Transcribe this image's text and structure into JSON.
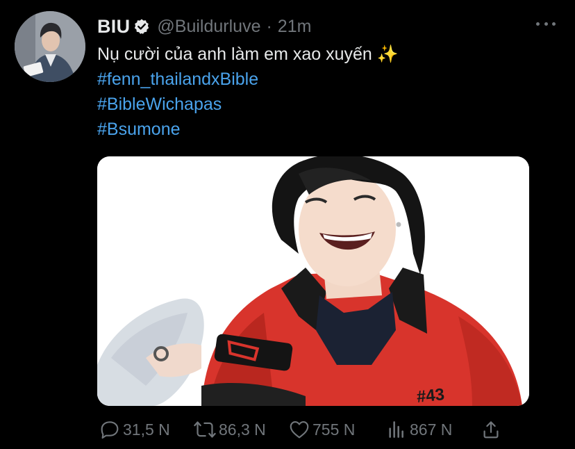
{
  "tweet": {
    "display_name": "BIU",
    "handle": "@Buildurluve",
    "separator": "·",
    "time": "21m",
    "text": "Nụ cười của anh làm em xao xuyến ✨",
    "hashtags": [
      "#fenn_thailandxBible",
      "#BibleWichapas",
      "#Bsumone"
    ],
    "verified_icon": "verified-badge-icon",
    "more_icon": "more-dots-icon"
  },
  "media": {
    "jacket_text": "#43",
    "colors": {
      "jacket_red": "#d8342c",
      "collar_black": "#1a1a1a",
      "background": "#ffffff"
    }
  },
  "actions": {
    "reply": {
      "icon": "reply-icon",
      "count": "31,5 N"
    },
    "retweet": {
      "icon": "retweet-icon",
      "count": "86,3 N"
    },
    "like": {
      "icon": "heart-icon",
      "count": "755 N"
    },
    "views": {
      "icon": "views-chart-icon",
      "count": "867 N"
    },
    "share": {
      "icon": "share-icon"
    }
  },
  "colors": {
    "background": "#000000",
    "text_primary": "#e7e9ea",
    "text_secondary": "#71767b",
    "hashtag": "#4aa3ec"
  }
}
